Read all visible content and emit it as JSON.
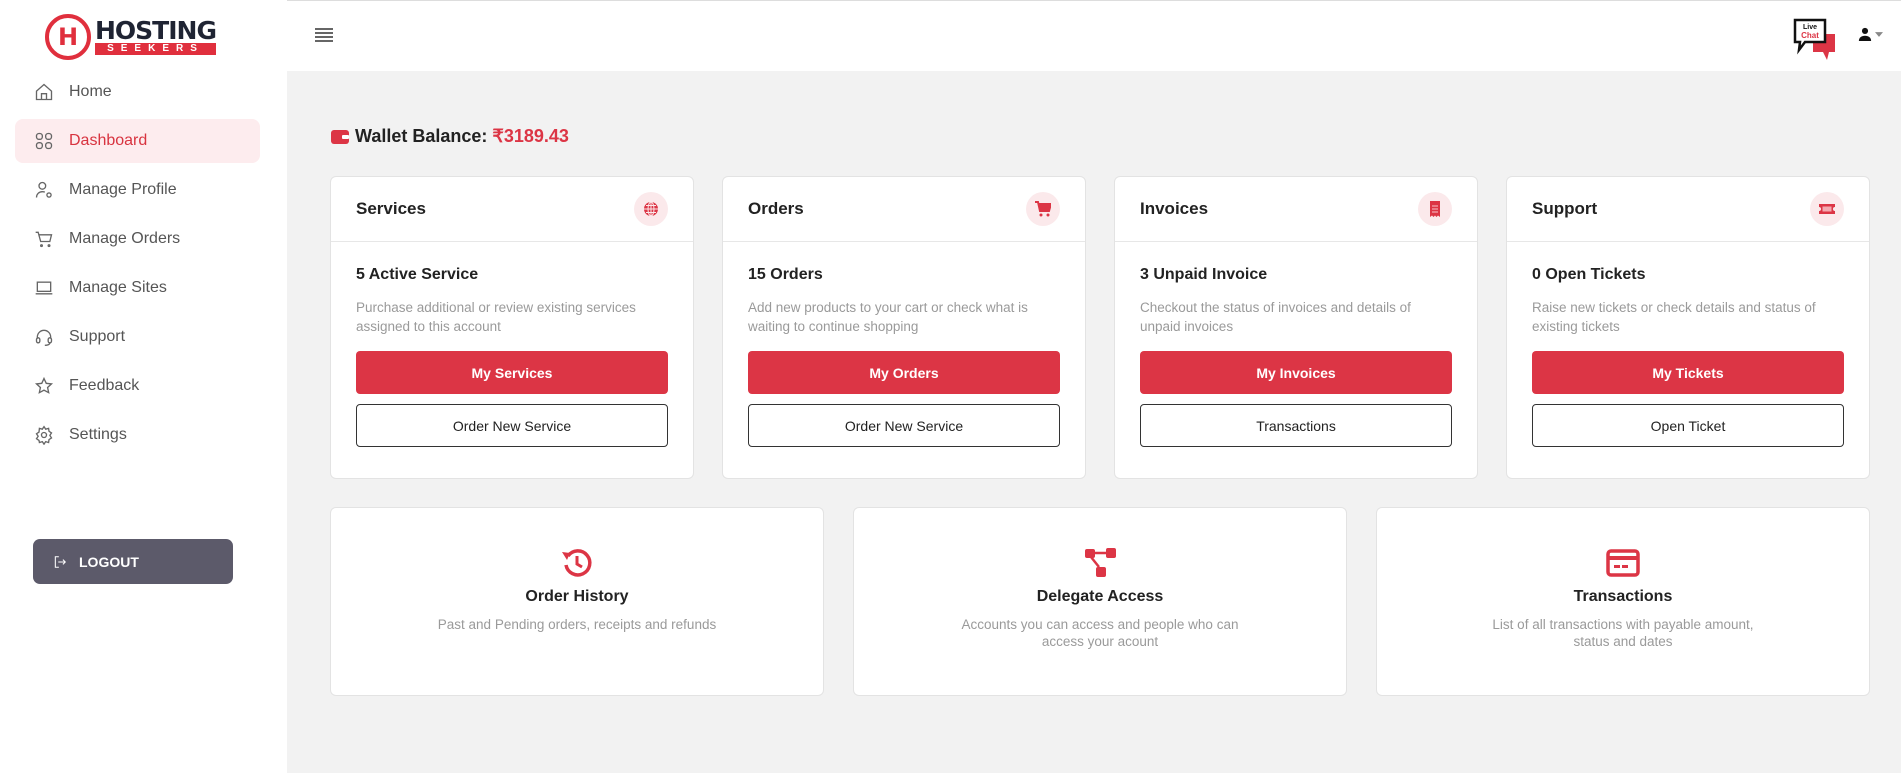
{
  "brand": {
    "name_top": "HOSTING",
    "name_bottom": "SEEKERS",
    "accent": "#dc3545"
  },
  "sidebar": {
    "items": [
      {
        "label": "Home",
        "icon": "home-icon",
        "active": false
      },
      {
        "label": "Dashboard",
        "icon": "dashboard-grid-icon",
        "active": true
      },
      {
        "label": "Manage Profile",
        "icon": "user-gear-icon",
        "active": false
      },
      {
        "label": "Manage Orders",
        "icon": "cart-icon",
        "active": false
      },
      {
        "label": "Manage Sites",
        "icon": "laptop-icon",
        "active": false
      },
      {
        "label": "Support",
        "icon": "headset-icon",
        "active": false
      },
      {
        "label": "Feedback",
        "icon": "star-icon",
        "active": false
      },
      {
        "label": "Settings",
        "icon": "gear-icon",
        "active": false
      }
    ],
    "logout_label": "LOGOUT"
  },
  "header": {
    "livechat_line1": "Live",
    "livechat_line2": "Chat"
  },
  "wallet": {
    "label": "Wallet Balance:",
    "amount": "₹3189.43"
  },
  "cards": [
    {
      "title": "Services",
      "icon": "globe-icon",
      "stat": "5 Active Service",
      "desc": "Purchase additional or review existing services assigned to this account",
      "primary": "My Services",
      "secondary": "Order New Service"
    },
    {
      "title": "Orders",
      "icon": "cart-icon",
      "stat": "15 Orders",
      "desc": "Add new products to your cart or check what is waiting to continue shopping",
      "primary": "My Orders",
      "secondary": "Order New Service"
    },
    {
      "title": "Invoices",
      "icon": "receipt-icon",
      "stat": "3 Unpaid Invoice",
      "desc": "Checkout the status of invoices and details of unpaid invoices",
      "primary": "My Invoices",
      "secondary": "Transactions"
    },
    {
      "title": "Support",
      "icon": "ticket-icon",
      "stat": "0 Open Tickets",
      "desc": "Raise new tickets or check details and status of existing tickets",
      "primary": "My Tickets",
      "secondary": "Open Ticket"
    }
  ],
  "tiles": [
    {
      "title": "Order History",
      "icon": "history-icon",
      "desc": "Past and Pending orders, receipts and refunds"
    },
    {
      "title": "Delegate Access",
      "icon": "sitemap-icon",
      "desc": "Accounts you can access and people who can access your acount"
    },
    {
      "title": "Transactions",
      "icon": "credit-card-icon",
      "desc": "List of all transactions with payable amount, status and dates"
    }
  ]
}
